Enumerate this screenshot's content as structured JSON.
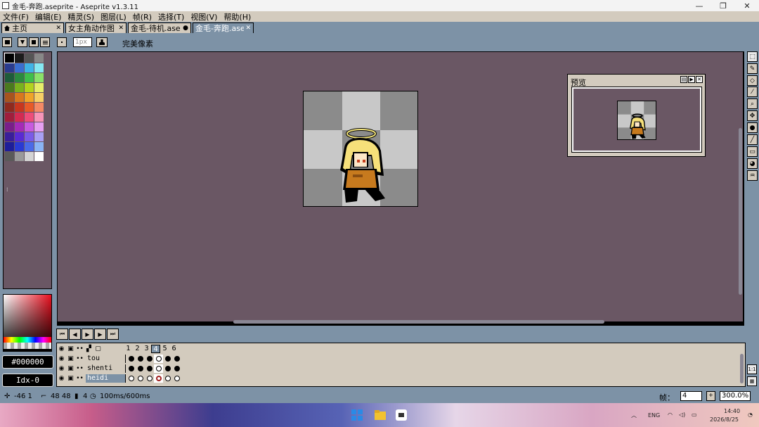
{
  "window": {
    "title": "金毛-奔跑.aseprite - Aseprite v1.3.11",
    "buttons": [
      "—",
      "❐",
      "✕"
    ]
  },
  "menu": [
    "文件(F)",
    "编辑(E)",
    "精灵(S)",
    "图层(L)",
    "帧(R)",
    "选择(T)",
    "视图(V)",
    "帮助(H)"
  ],
  "tabs": [
    {
      "label": "主页",
      "close": "✕"
    },
    {
      "label": "女主角动作图",
      "close": "✕"
    },
    {
      "label": "金毛-待机.ase",
      "close": "●"
    },
    {
      "label": "金毛-奔跑.ase",
      "close": "✕"
    }
  ],
  "toolbar": {
    "brush_size": "1px",
    "pixel_perfect": "完美像素"
  },
  "palette": {
    "colors": [
      "#000000",
      "#1c1c1c",
      "#555555",
      "#888888",
      "#2a3c8f",
      "#3a6fd1",
      "#3fb3e6",
      "#86e8f2",
      "#1e5c3a",
      "#2b8a3e",
      "#3fbf4a",
      "#8be36a",
      "#4a7a1e",
      "#79b21e",
      "#b2d41e",
      "#e6ee6a",
      "#a8541e",
      "#d9781e",
      "#f0a428",
      "#f7d066",
      "#8f2a1e",
      "#c8361e",
      "#e85a28",
      "#f58a66",
      "#a01e3c",
      "#d42a52",
      "#ee4c7a",
      "#f794b8",
      "#7a1e8a",
      "#a62ab8",
      "#c85ae0",
      "#e6a0f2",
      "#3a1e9a",
      "#5a2ad4",
      "#7a5ae8",
      "#a9a0f5",
      "#1e1e9a",
      "#2a3ad4",
      "#4a6ae8",
      "#8ab4f5",
      "#5a5a5a",
      "#9a9a9a",
      "#d4d4d4",
      "#ffffff"
    ],
    "fg_hex": "#000000",
    "index": "Idx-0"
  },
  "preview": {
    "title": "预览",
    "btns": [
      "▤",
      "▶",
      "✕"
    ]
  },
  "tools": [
    "select-icon",
    "pencil-icon",
    "eraser-icon",
    "eyedropper-icon",
    "zoom-icon",
    "move-icon",
    "fill-icon",
    "line-icon",
    "rect-icon",
    "blur-icon",
    "smudge-icon"
  ],
  "timeline": {
    "frames": [
      "1",
      "2",
      "3",
      "4",
      "5",
      "6"
    ],
    "current_frame_index": 3,
    "layers": [
      {
        "name": "tou",
        "cels": [
          "dot",
          "dot",
          "dot",
          "ring",
          "dot",
          "dot"
        ]
      },
      {
        "name": "shenti",
        "cels": [
          "dot",
          "dot",
          "dot",
          "ring",
          "dot",
          "dot"
        ]
      },
      {
        "name": "heidi",
        "cels": [
          "ring",
          "ring",
          "ring",
          "ring",
          "ring",
          "ring"
        ]
      }
    ]
  },
  "status": {
    "pos": "-46  1",
    "size": "48  48",
    "frame": "4",
    "duration": "100ms/600ms",
    "frame_label": "帧：",
    "frame_value": "4",
    "zoom": "300.0%"
  },
  "taskbar": {
    "lang": "ENG",
    "time": "14:40",
    "date": "2026/8/25"
  }
}
